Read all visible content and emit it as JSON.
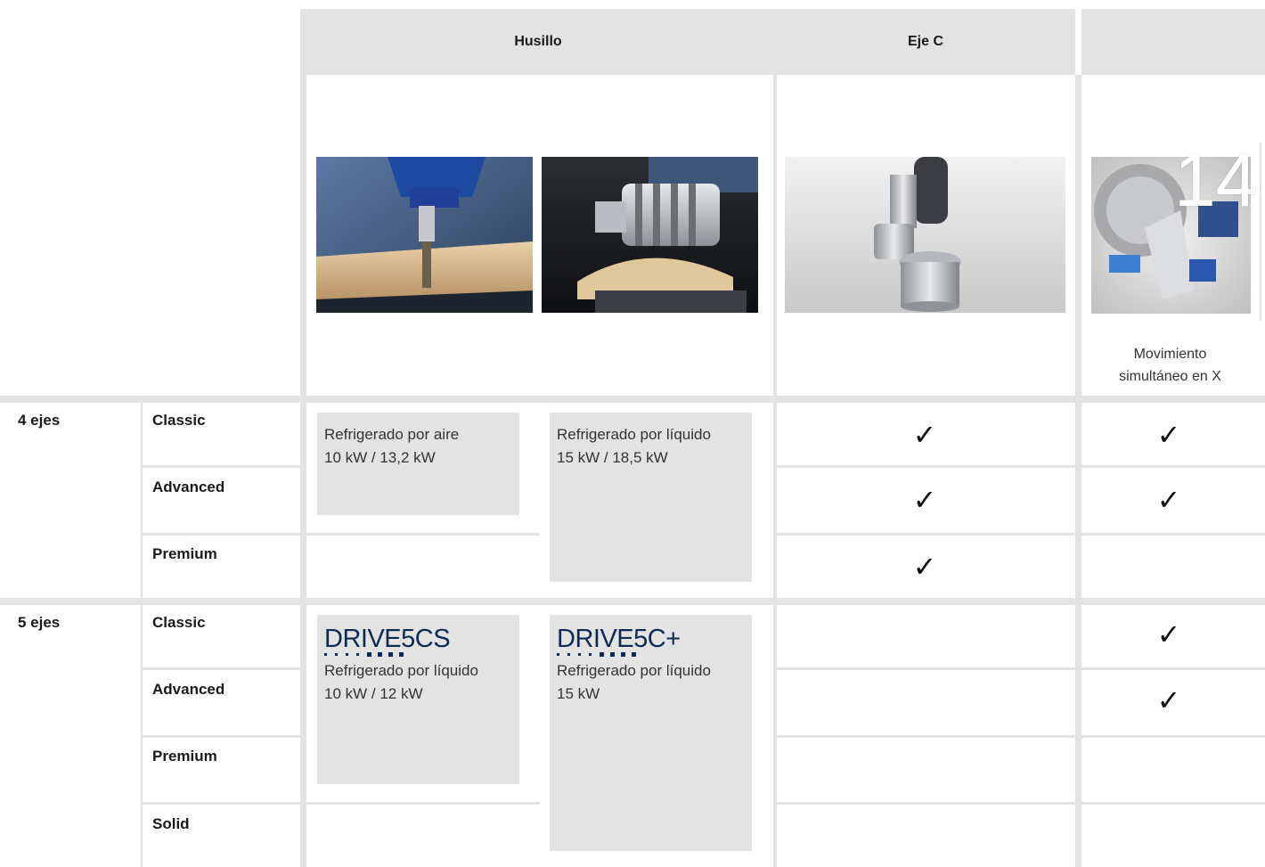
{
  "header": {
    "col_spindle": "Husillo",
    "col_c_axis": "Eje C",
    "col_extra": ""
  },
  "page_number": "14",
  "extra_caption": "Movimiento simultáneo en X",
  "groups": [
    {
      "axes": "4 ejes",
      "levels": [
        "Classic",
        "Advanced",
        "Premium"
      ],
      "spindle_a": {
        "logo": "",
        "lines": [
          "Refrigerado por aire",
          "10 kW / 13,2 kW"
        ]
      },
      "spindle_b": {
        "logo": "",
        "lines": [
          "Refrigerado por líquido",
          "15 kW / 18,5 kW"
        ]
      },
      "c_axis_checks": [
        true,
        true,
        true
      ],
      "extra_checks": [
        true,
        true,
        false
      ]
    },
    {
      "axes": "5 ejes",
      "levels": [
        "Classic",
        "Advanced",
        "Premium",
        "Solid"
      ],
      "spindle_a": {
        "logo": "DRIVE5CS",
        "lines": [
          "Refrigerado por líquido",
          "10 kW / 12 kW"
        ]
      },
      "spindle_b": {
        "logo": "DRIVE5C+",
        "lines": [
          "Refrigerado por líquido",
          "15 kW"
        ]
      },
      "c_axis_checks": [
        false,
        false,
        false,
        false
      ],
      "extra_checks": [
        true,
        true,
        false,
        false
      ]
    }
  ],
  "check_glyph": "✓",
  "colors": {
    "separator": "#e3e3e3",
    "logo": "#0d2a52"
  },
  "images": [
    "spindle-air-cooled-photo",
    "spindle-liquid-cooled-photo",
    "c-axis-unit-photo",
    "x-axis-aggregate-photo"
  ]
}
